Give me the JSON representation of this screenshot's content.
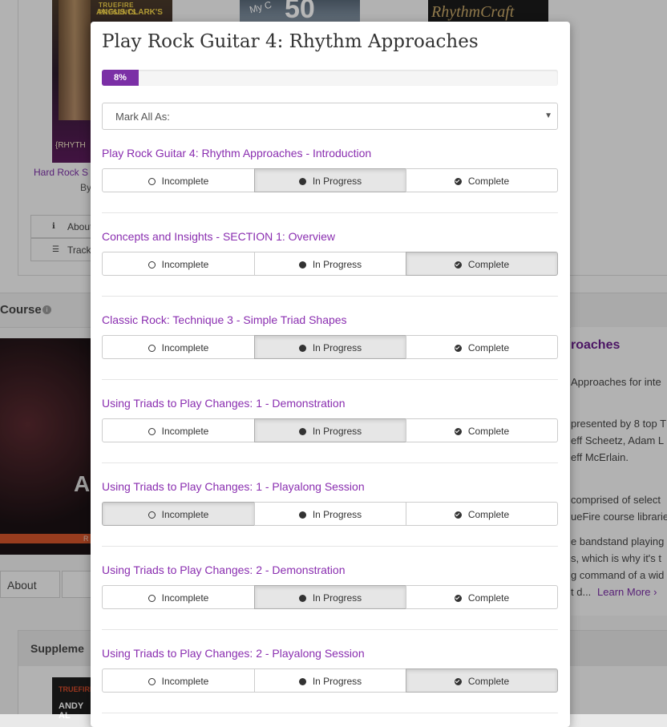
{
  "background": {
    "covers": [
      {
        "line1": "TRUEFIRE PRESENTS",
        "line2": "ANGUS CLARK'S",
        "line3": "{RHYTH"
      },
      {
        "line1": "My C",
        "line2": "50"
      },
      {
        "line1": "RhythmCraft"
      }
    ],
    "course_link": "Hard Rock S",
    "by": "By",
    "buttons": [
      "About",
      "Track"
    ],
    "section_label": "Course",
    "video_letter": "A",
    "video_bar_text": "R",
    "about_tab": "About",
    "right_title": "roaches",
    "right_lines": [
      "Approaches for inte",
      "presented by 8 top T",
      "eff Scheetz, Adam L",
      "eff McErlain.",
      "comprised of select",
      "ueFire course librarie",
      "e bandstand playing",
      "s, which is why it's t",
      "g command of a wid",
      "t d..."
    ],
    "learn_more": "Learn More ›",
    "supplement_header": "Suppleme",
    "supp_cover": {
      "line1": "TRUEFIRE",
      "line2": "ANDY AL"
    }
  },
  "modal": {
    "title": "Play Rock Guitar 4: Rhythm Approaches",
    "progress": {
      "percent": 8,
      "label": "8%",
      "color": "#7b2fa6"
    },
    "mark_all": {
      "label": "Mark All As:",
      "caret": "▼"
    },
    "option_labels": {
      "incomplete": "Incomplete",
      "in_progress": "In Progress",
      "complete": "Complete"
    },
    "lessons": [
      {
        "title": "Play Rock Guitar 4: Rhythm Approaches - Introduction",
        "status": "in_progress"
      },
      {
        "title": "Concepts and Insights - SECTION 1: Overview",
        "status": "complete"
      },
      {
        "title": "Classic Rock: Technique 3 - Simple Triad Shapes",
        "status": "in_progress"
      },
      {
        "title": "Using Triads to Play Changes: 1 - Demonstration",
        "status": "in_progress"
      },
      {
        "title": "Using Triads to Play Changes: 1 - Playalong Session",
        "status": "incomplete"
      },
      {
        "title": "Using Triads to Play Changes: 2 - Demonstration",
        "status": "in_progress"
      },
      {
        "title": "Using Triads to Play Changes: 2 - Playalong Session",
        "status": "complete"
      }
    ]
  }
}
